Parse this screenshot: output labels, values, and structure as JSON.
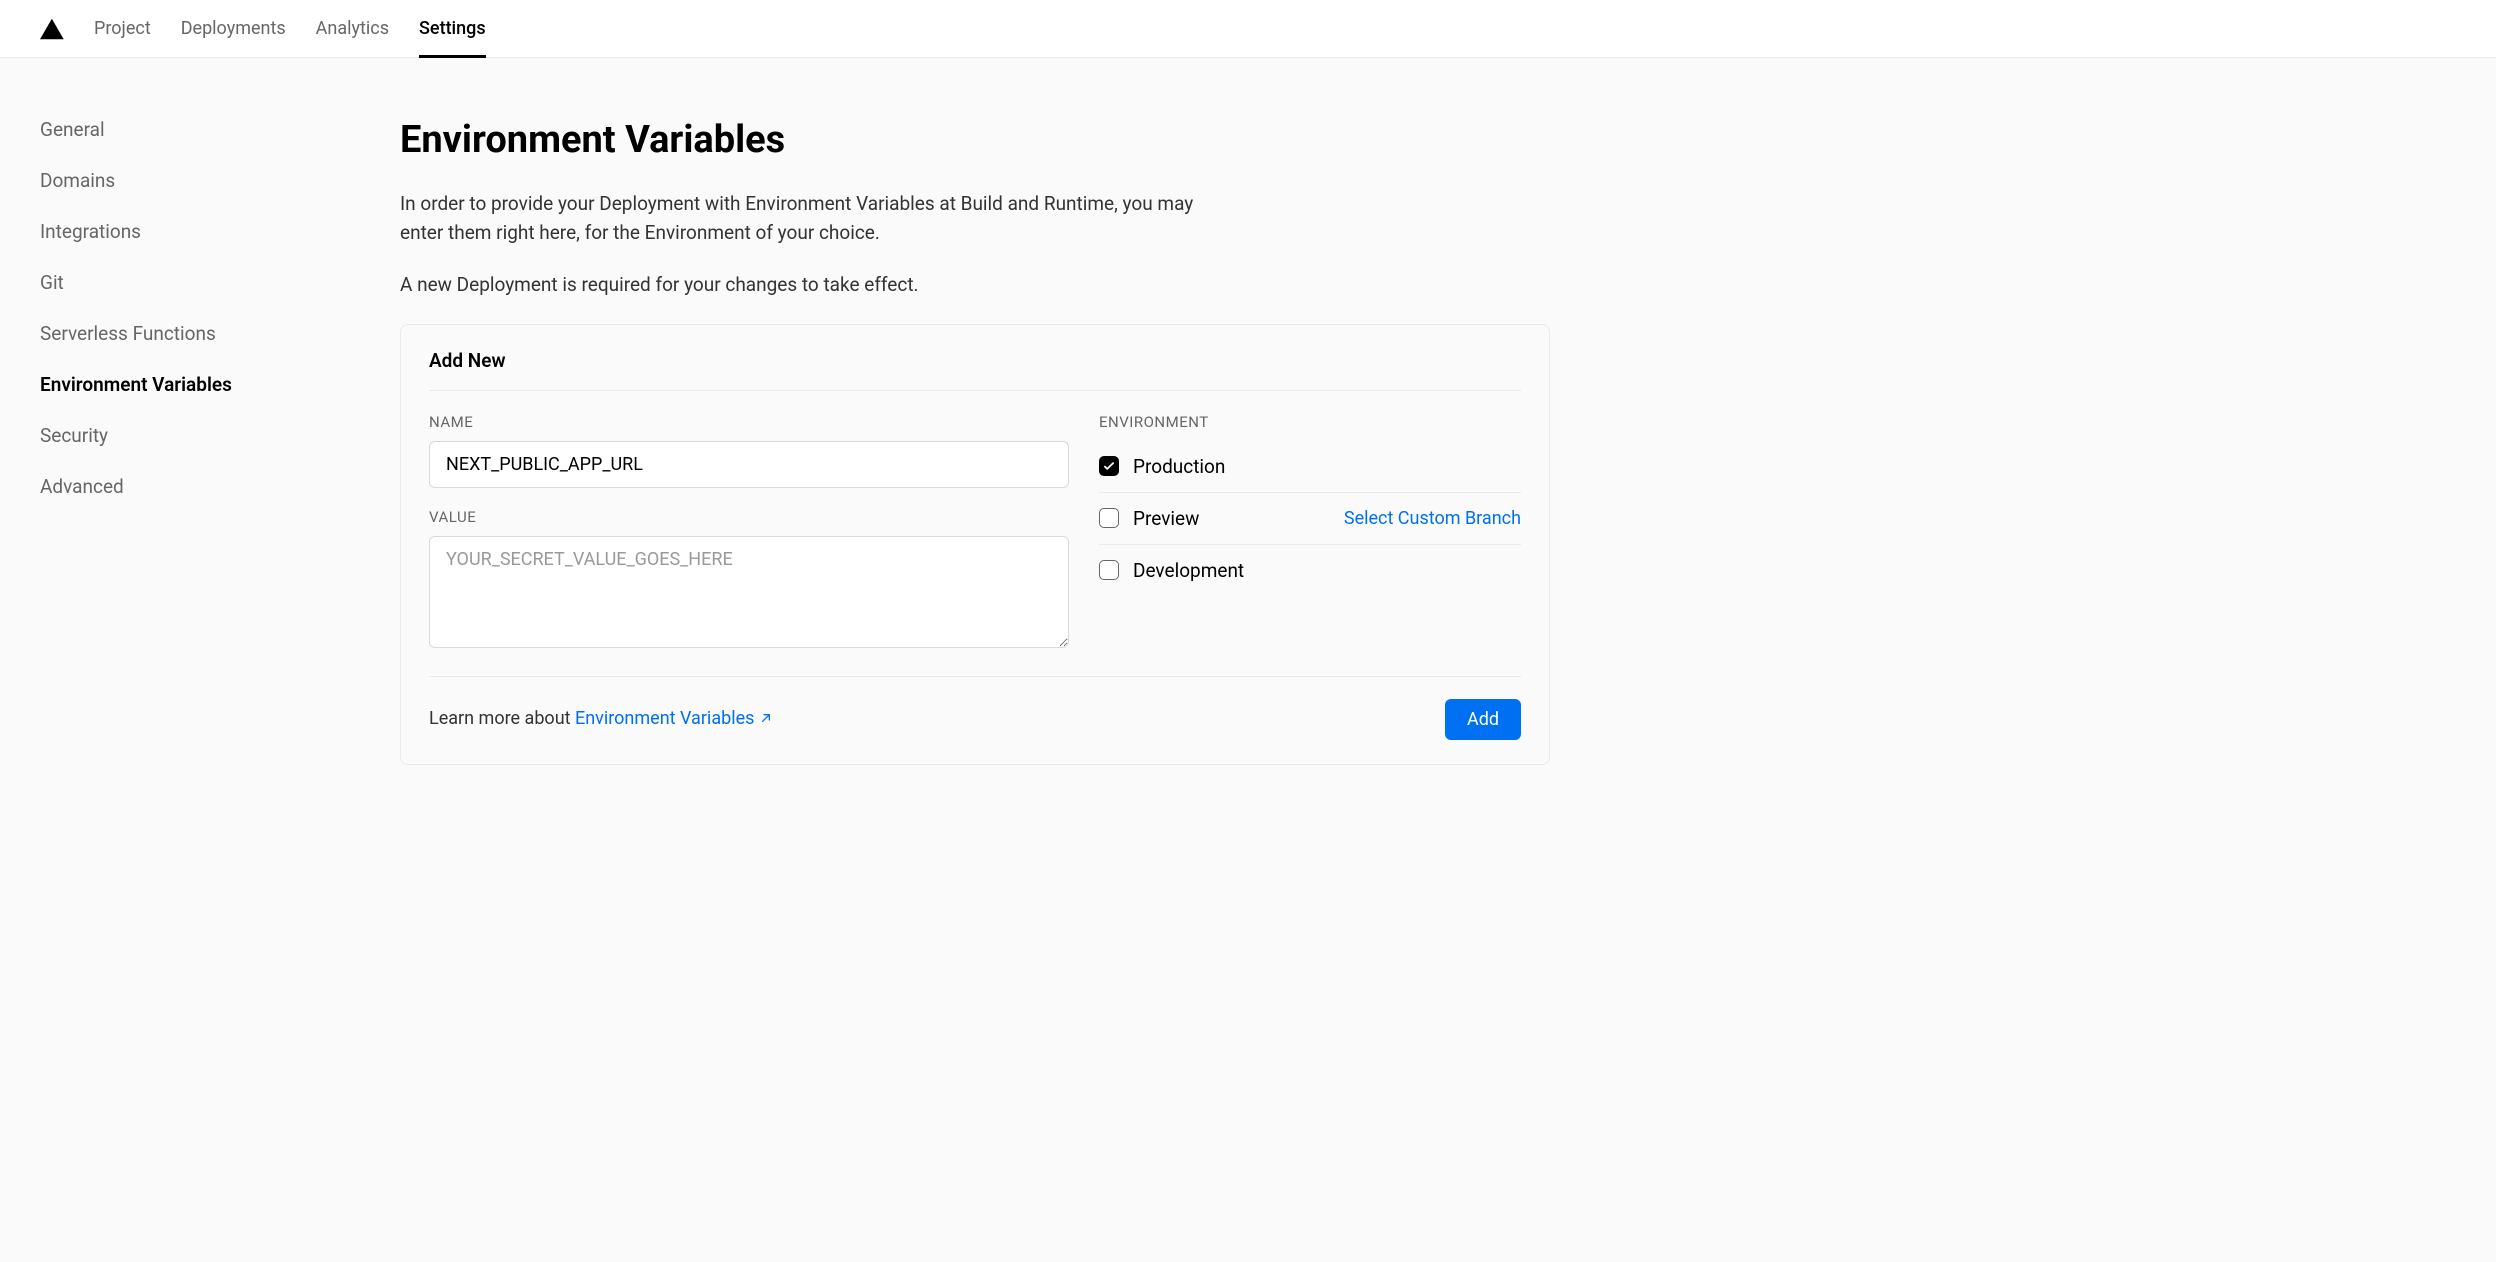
{
  "nav": {
    "items": [
      {
        "label": "Project",
        "active": false
      },
      {
        "label": "Deployments",
        "active": false
      },
      {
        "label": "Analytics",
        "active": false
      },
      {
        "label": "Settings",
        "active": true
      }
    ]
  },
  "sidebar": {
    "items": [
      {
        "label": "General",
        "active": false
      },
      {
        "label": "Domains",
        "active": false
      },
      {
        "label": "Integrations",
        "active": false
      },
      {
        "label": "Git",
        "active": false
      },
      {
        "label": "Serverless Functions",
        "active": false
      },
      {
        "label": "Environment Variables",
        "active": true
      },
      {
        "label": "Security",
        "active": false
      },
      {
        "label": "Advanced",
        "active": false
      }
    ]
  },
  "page": {
    "title": "Environment Variables",
    "desc1": "In order to provide your Deployment with Environment Variables at Build and Runtime, you may enter them right here, for the Environment of your choice.",
    "desc2": "A new Deployment is required for your changes to take effect."
  },
  "card": {
    "title": "Add New",
    "nameLabel": "NAME",
    "nameValue": "NEXT_PUBLIC_APP_URL",
    "valueLabel": "VALUE",
    "valuePlaceholder": "YOUR_SECRET_VALUE_GOES_HERE",
    "valueValue": "",
    "envLabel": "ENVIRONMENT",
    "environments": [
      {
        "label": "Production",
        "checked": true
      },
      {
        "label": "Preview",
        "checked": false,
        "link": "Select Custom Branch"
      },
      {
        "label": "Development",
        "checked": false
      }
    ],
    "footerText": "Learn more about ",
    "footerLink": "Environment Variables",
    "addButton": "Add"
  }
}
